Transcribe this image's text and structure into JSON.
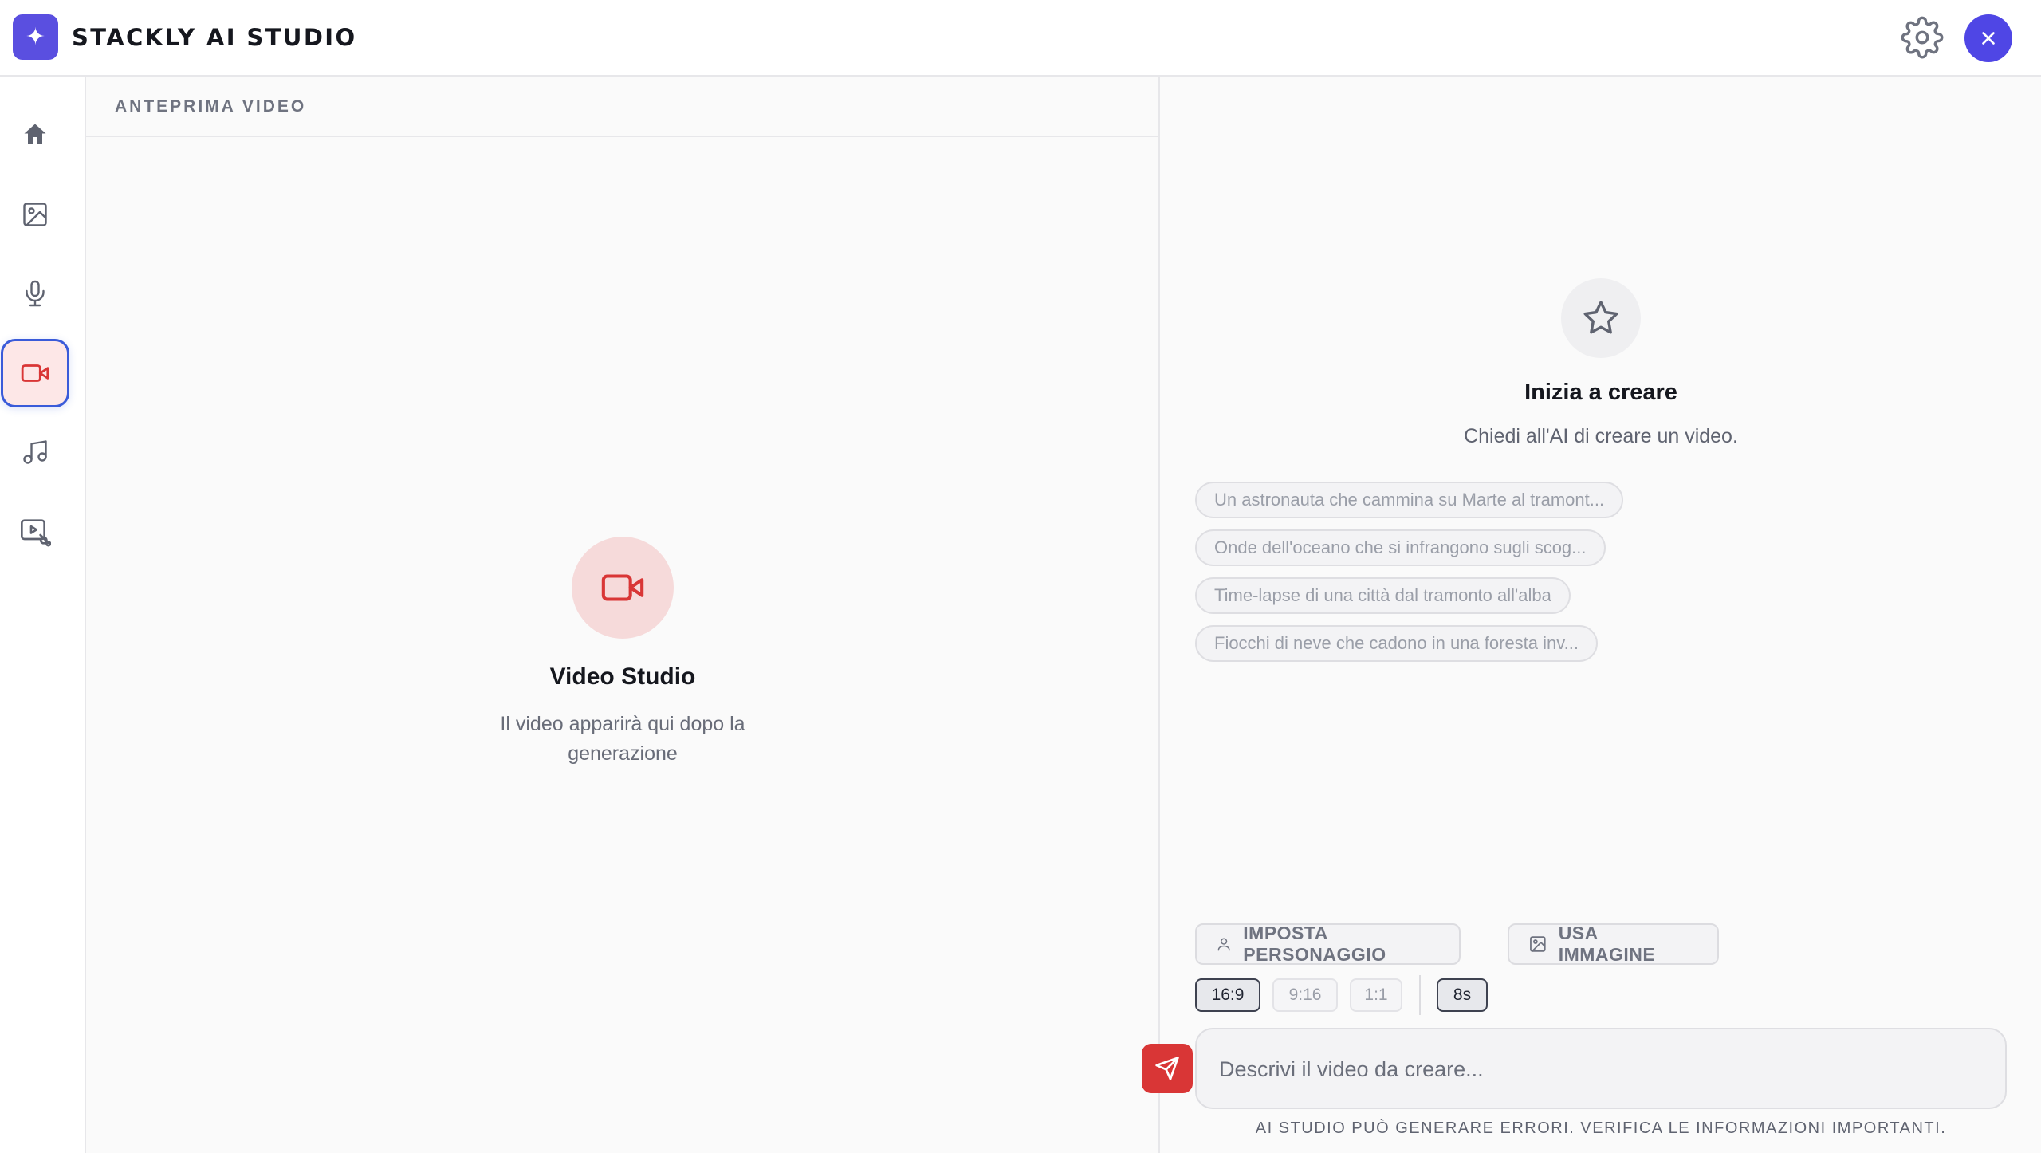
{
  "app": {
    "logo_glyph": "✦",
    "title": "STACKLY AI STUDIO",
    "accent_color": "#4f46e5",
    "red_accent": "#d93636"
  },
  "sidebar": {
    "items": [
      {
        "icon": "home-icon",
        "active": false
      },
      {
        "icon": "image-icon",
        "active": false
      },
      {
        "icon": "microphone-icon",
        "active": false
      },
      {
        "icon": "video-camera-icon",
        "active": true
      },
      {
        "icon": "music-note-icon",
        "active": false
      },
      {
        "icon": "video-edit-icon",
        "active": false
      }
    ]
  },
  "preview": {
    "header": "ANTEPRIMA VIDEO",
    "empty_title": "Video Studio",
    "empty_subtitle": "Il video apparirà qui dopo la generazione"
  },
  "chat": {
    "title": "Inizia a creare",
    "subtitle": "Chiedi all'AI di creare un video.",
    "suggestions": [
      "Un astronauta che cammina su Marte al tramont...",
      "Onde dell'oceano che si infrangono sugli scog...",
      "Time-lapse di una città dal tramonto all'alba",
      "Fiocchi di neve che cadono in una foresta inv..."
    ],
    "tools": {
      "character": "IMPOSTA PERSONAGGIO",
      "image": "USA IMMAGINE"
    },
    "ratios": [
      "16:9",
      "9:16",
      "1:1"
    ],
    "selected_ratio": "16:9",
    "duration": "8s",
    "input_placeholder": "Descrivi il video da creare...",
    "input_value": "",
    "disclaimer": "AI STUDIO PUÒ GENERARE ERRORI. VERIFICA LE INFORMAZIONI IMPORTANTI."
  }
}
